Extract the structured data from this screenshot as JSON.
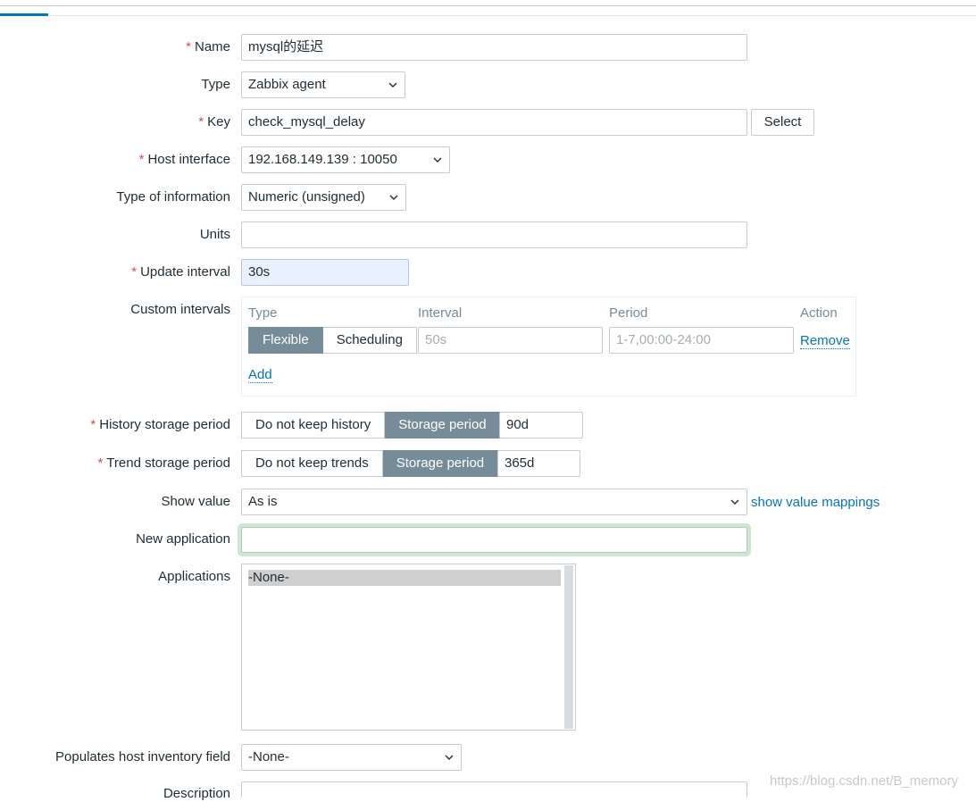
{
  "form": {
    "name": {
      "label": "Name",
      "value": "mysql的延迟"
    },
    "type": {
      "label": "Type",
      "value": "Zabbix agent"
    },
    "key": {
      "label": "Key",
      "value": "check_mysql_delay",
      "select_label": "Select"
    },
    "host_interface": {
      "label": "Host interface",
      "value": "192.168.149.139 : 10050"
    },
    "type_of_information": {
      "label": "Type of information",
      "value": "Numeric (unsigned)"
    },
    "units": {
      "label": "Units",
      "value": ""
    },
    "update_interval": {
      "label": "Update interval",
      "value": "30s"
    },
    "custom_intervals": {
      "label": "Custom intervals",
      "headers": {
        "type": "Type",
        "interval": "Interval",
        "period": "Period",
        "action": "Action"
      },
      "row": {
        "flexible": "Flexible",
        "scheduling": "Scheduling",
        "interval_placeholder": "50s",
        "period_placeholder": "1-7,00:00-24:00",
        "remove": "Remove"
      },
      "add": "Add"
    },
    "history_storage": {
      "label": "History storage period",
      "option_none": "Do not keep history",
      "option_storage": "Storage period",
      "value": "90d"
    },
    "trend_storage": {
      "label": "Trend storage period",
      "option_none": "Do not keep trends",
      "option_storage": "Storage period",
      "value": "365d"
    },
    "show_value": {
      "label": "Show value",
      "value": "As is",
      "link": "show value mappings"
    },
    "new_application": {
      "label": "New application",
      "value": ""
    },
    "applications": {
      "label": "Applications",
      "items": [
        "-None-"
      ]
    },
    "inventory_field": {
      "label": "Populates host inventory field",
      "value": "-None-"
    },
    "description": {
      "label": "Description"
    }
  },
  "watermark": "https://blog.csdn.net/B_memory",
  "colors": {
    "accent": "#0275b8",
    "required": "#d64e4e",
    "segment_active": "#768d99",
    "focus_glow": "#cce8cf"
  },
  "icons": {
    "dropdown": "chevron-down-icon"
  }
}
